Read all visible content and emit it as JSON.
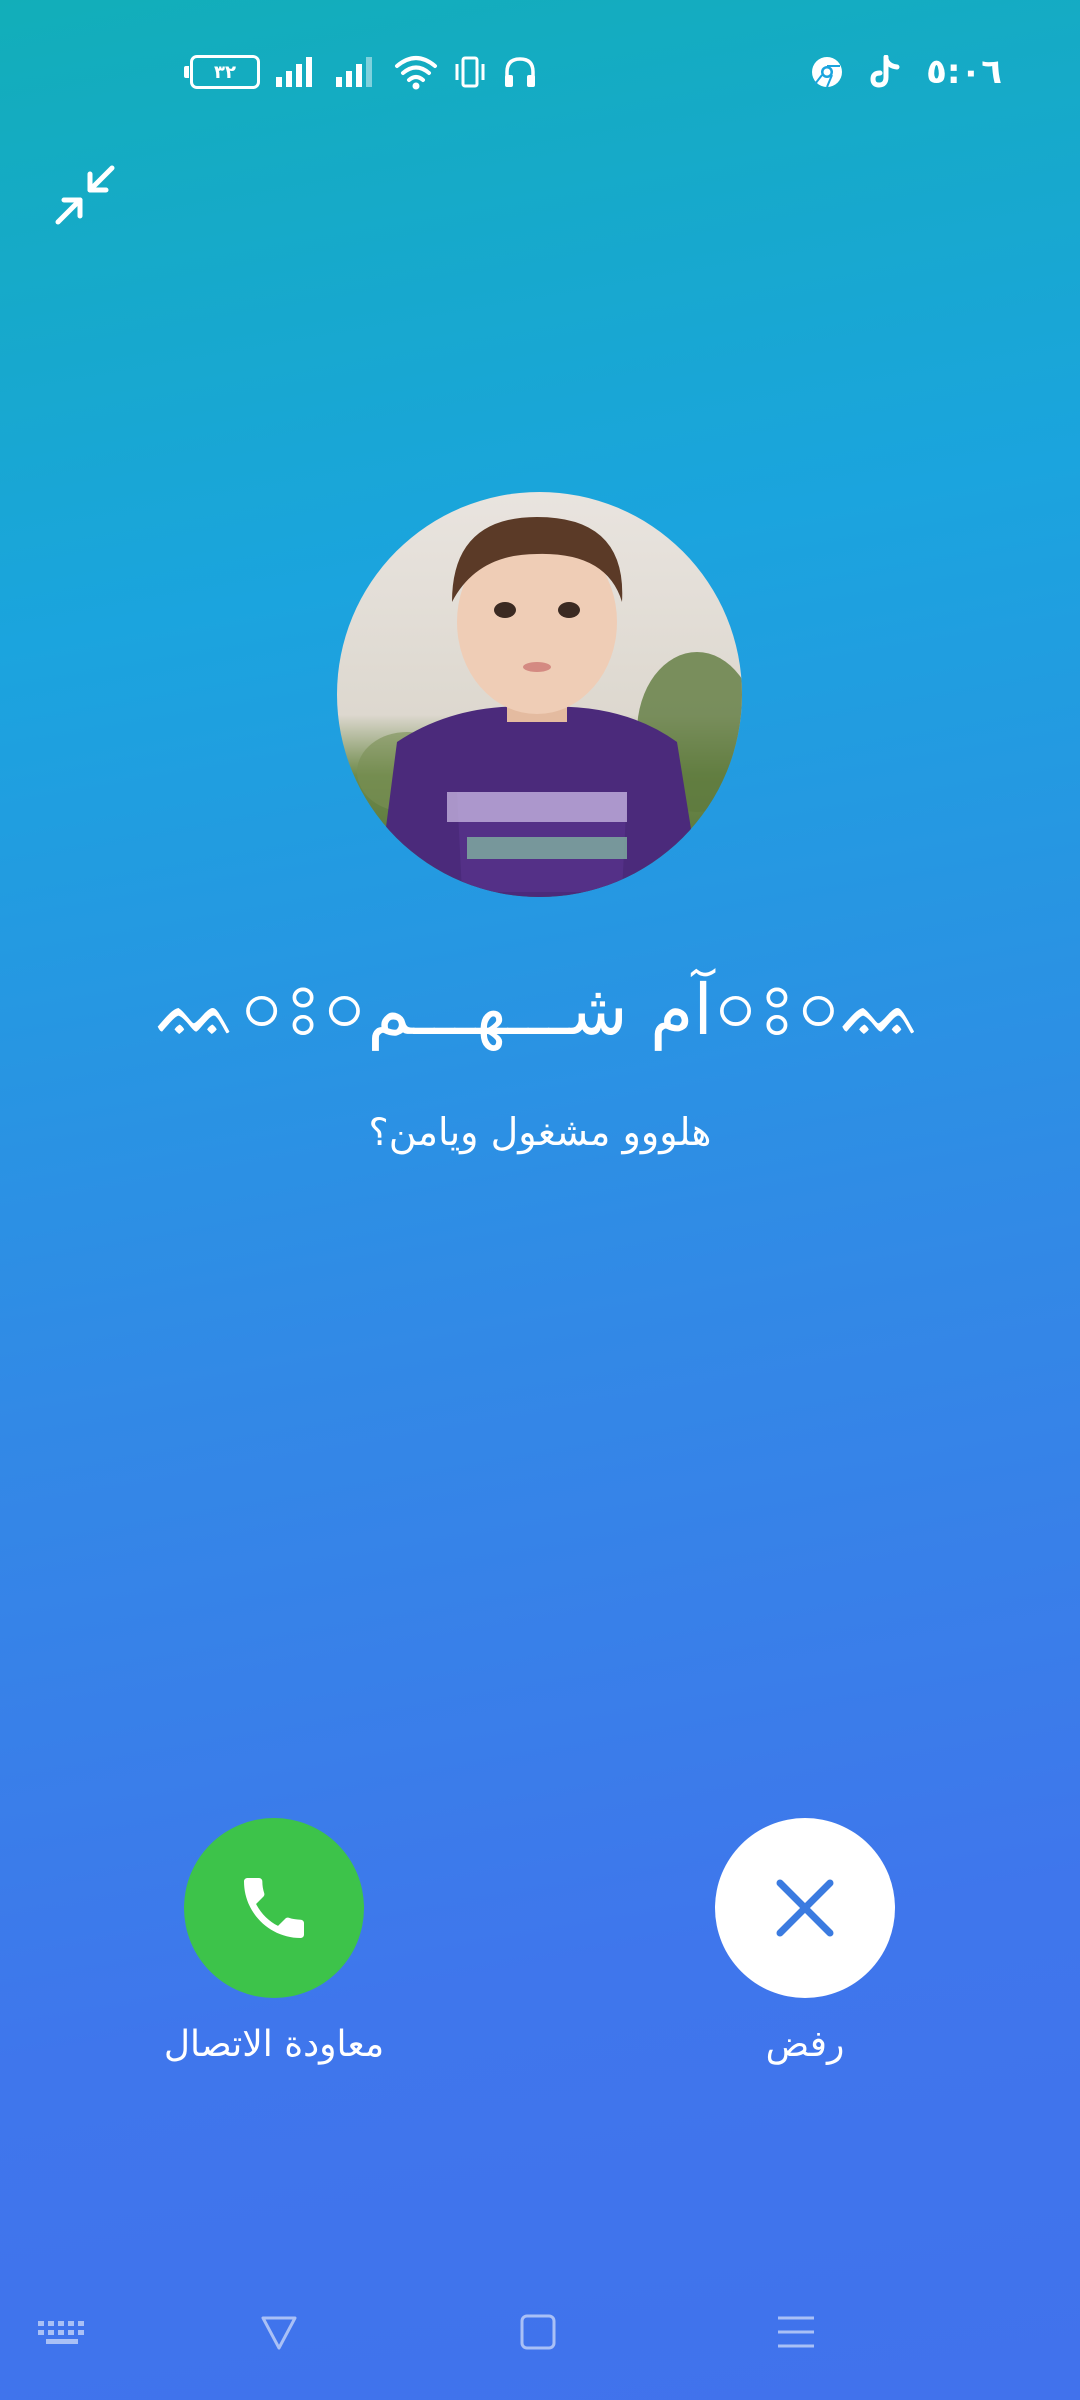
{
  "status_bar": {
    "battery_level": "٣٢",
    "time": "٥:٠٦",
    "icons": [
      "battery-icon",
      "signal-icon-sim1",
      "signal-icon-sim2",
      "wifi-icon",
      "vibrate-icon",
      "headphones-icon",
      "chrome-icon",
      "tiktok-icon"
    ]
  },
  "call": {
    "caller_name": "ᨐ০ঃ০آم شـــهـــم০ঃ০ᨐ",
    "message": "هلووو مشغول ويامن؟"
  },
  "actions": {
    "callback_label": "معاودة الاتصال",
    "reject_label": "رفض"
  },
  "colors": {
    "callback_green": "#3dc34a",
    "reject_icon_blue": "#3b7be0",
    "gradient_top": "#12aeb9",
    "gradient_bottom": "#4172ec"
  },
  "nav_bar": {
    "icons": [
      "keyboard-icon",
      "back-triangle-icon",
      "home-square-icon",
      "menu-lines-icon"
    ]
  }
}
